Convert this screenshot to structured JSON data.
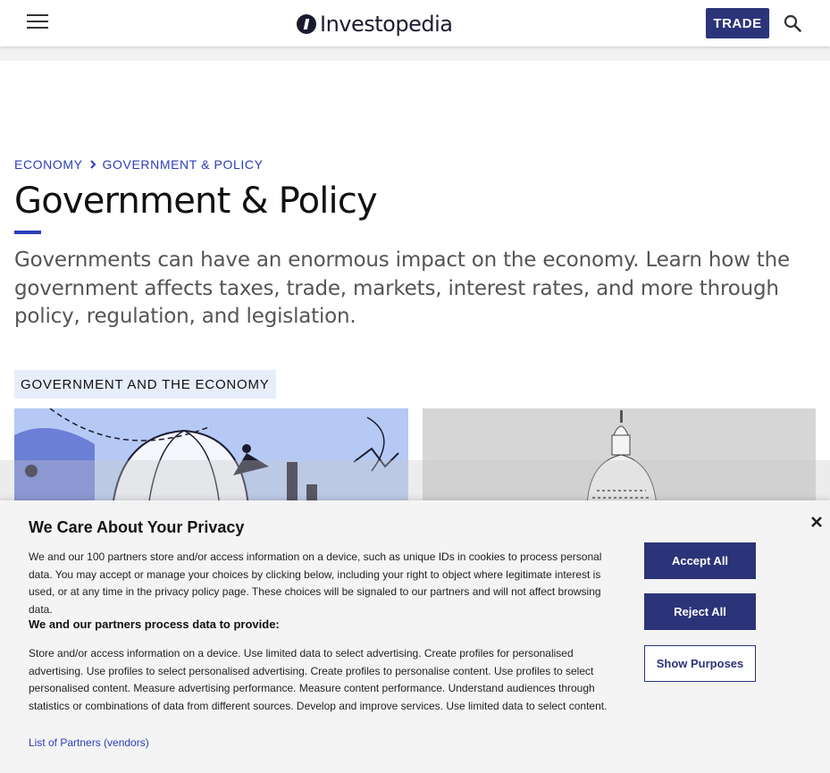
{
  "header": {
    "logo_text": "Investopedia",
    "trade_label": "TRADE",
    "brand_color": "#2c3479",
    "icons": [
      "menu-icon",
      "search-icon"
    ]
  },
  "breadcrumb": {
    "items": [
      "ECONOMY",
      "GOVERNMENT & POLICY"
    ],
    "separator_icon": "chevron-right-icon"
  },
  "page": {
    "title": "Government & Policy",
    "description": "Governments can have an enormous impact on the economy. Learn how the government affects taxes, trade, markets, interest rates, and more through policy, regulation, and legislation.",
    "section_tag": "GOVERNMENT AND THE ECONOMY",
    "accent_color": "#2c3dbb"
  },
  "consent": {
    "title": "We Care About Your Privacy",
    "body": "We and our 100 partners store and/or access information on a device, such as unique IDs in cookies to process personal data. You may accept or manage your choices by clicking below, including your right to object where legitimate interest is used, or at any time in the privacy policy page. These choices will be signaled to our partners and will not affect browsing data.",
    "subhead": "We and our partners process data to provide:",
    "purposes": "Store and/or access information on a device. Use limited data to select advertising. Create profiles for personalised advertising. Use profiles to select personalised advertising. Create profiles to personalise content. Use profiles to select personalised content. Measure advertising performance. Measure content performance. Understand audiences through statistics or combinations of data from different sources. Develop and improve services. Use limited data to select content.",
    "partners_link": "List of Partners (vendors)",
    "accept_label": "Accept All",
    "reject_label": "Reject All",
    "purposes_label": "Show Purposes"
  }
}
